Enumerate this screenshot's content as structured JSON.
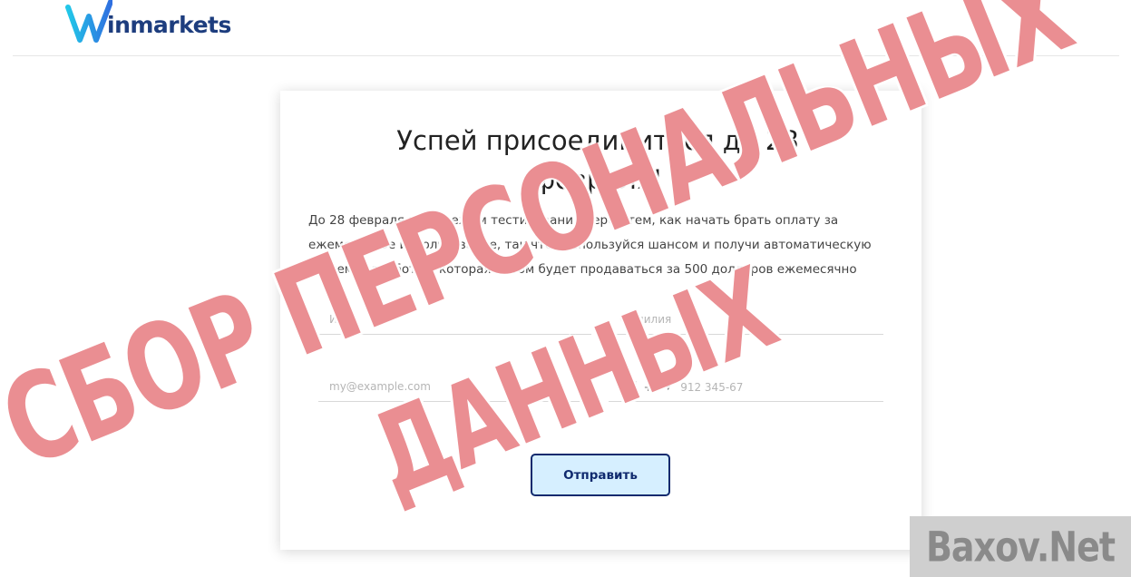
{
  "header": {
    "logo_text": "inmarkets",
    "logo_colors": {
      "mark_left": "#22c7e8",
      "mark_right": "#2f6fe0",
      "text": "#1d3d7e"
    }
  },
  "form": {
    "title": "Успей присоединиться до 28 февраля!",
    "description": "До 28 февраля идёт режим тестирования перед тем, как начать брать оплату за ежемесячное использование, так что воспользуйся шансом и получи автоматическую систему заработка, которая потом будет продаваться за 500 долларов ежемесячно",
    "first_name_placeholder": "Имя",
    "last_name_placeholder": "Фамилия",
    "email_placeholder": "my@example.com",
    "phone_country_code": "+7",
    "phone_placeholder": "912 345-67",
    "submit_label": "Отправить",
    "submit_colors": {
      "background": "#d6efff",
      "border": "#102a6e"
    }
  },
  "watermark": {
    "line1": "СБОР ПЕРСОНАЛЬНЫХ",
    "line2": "ДАННЫХ",
    "color": "#e26268",
    "site": "Baxov.Net"
  }
}
